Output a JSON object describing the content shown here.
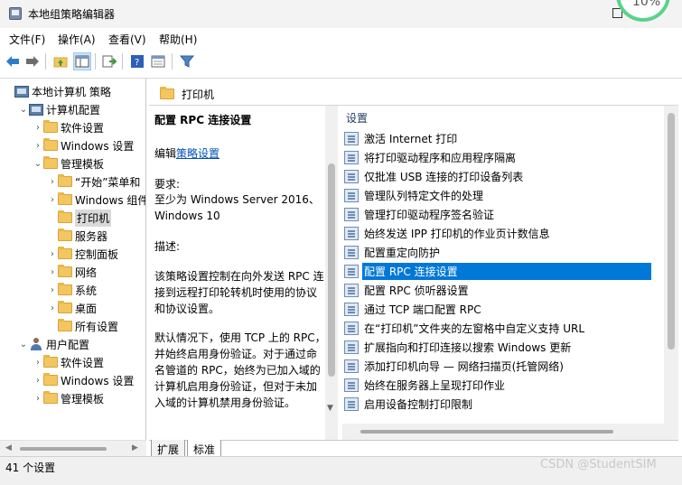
{
  "window": {
    "title": "本地组策略编辑器",
    "overlay_badge": "10%"
  },
  "menu": [
    "文件(F)",
    "操作(A)",
    "查看(V)",
    "帮助(H)"
  ],
  "toolbar": {
    "icons": [
      "back-arrow-icon",
      "forward-arrow-icon",
      "folder-up-icon",
      "show-hide-tree-icon",
      "export-list-icon",
      "help-icon",
      "properties-icon",
      "filter-icon"
    ]
  },
  "tree": [
    {
      "label": "本地计算机 策略",
      "icon": "computer-icon",
      "indent": 0,
      "chevron": ""
    },
    {
      "label": "计算机配置",
      "icon": "computer-icon",
      "indent": 1,
      "chevron": "expanded"
    },
    {
      "label": "软件设置",
      "icon": "folder-icon",
      "indent": 2,
      "chevron": "collapsed"
    },
    {
      "label": "Windows 设置",
      "icon": "folder-icon",
      "indent": 2,
      "chevron": "collapsed"
    },
    {
      "label": "管理模板",
      "icon": "folder-icon",
      "indent": 2,
      "chevron": "expanded"
    },
    {
      "label": "“开始”菜单和",
      "icon": "folder-icon",
      "indent": 3,
      "chevron": "collapsed"
    },
    {
      "label": "Windows 组件",
      "icon": "folder-icon",
      "indent": 3,
      "chevron": "collapsed"
    },
    {
      "label": "打印机",
      "icon": "folder-icon",
      "indent": 3,
      "chevron": "",
      "selected": true
    },
    {
      "label": "服务器",
      "icon": "folder-icon",
      "indent": 3,
      "chevron": ""
    },
    {
      "label": "控制面板",
      "icon": "folder-icon",
      "indent": 3,
      "chevron": "collapsed"
    },
    {
      "label": "网络",
      "icon": "folder-icon",
      "indent": 3,
      "chevron": "collapsed"
    },
    {
      "label": "系统",
      "icon": "folder-icon",
      "indent": 3,
      "chevron": "collapsed"
    },
    {
      "label": "桌面",
      "icon": "folder-icon",
      "indent": 3,
      "chevron": "collapsed"
    },
    {
      "label": "所有设置",
      "icon": "folder-icon",
      "indent": 3,
      "chevron": ""
    },
    {
      "label": "用户配置",
      "icon": "user-icon",
      "indent": 1,
      "chevron": "expanded"
    },
    {
      "label": "软件设置",
      "icon": "folder-icon",
      "indent": 2,
      "chevron": "collapsed"
    },
    {
      "label": "Windows 设置",
      "icon": "folder-icon",
      "indent": 2,
      "chevron": "collapsed"
    },
    {
      "label": "管理模板",
      "icon": "folder-icon",
      "indent": 2,
      "chevron": "collapsed"
    }
  ],
  "pane": {
    "header": "打印机",
    "column_header": "设置"
  },
  "description": {
    "title": "配置 RPC 连接设置",
    "edit_prefix": "编辑",
    "edit_link": "策略设置",
    "requirements_label": "要求:",
    "requirements": "至少为 Windows Server 2016、Windows 10",
    "description_label": "描述:",
    "description": "该策略设置控制在向外发送 RPC 连接到远程打印轮转机时使用的协议和协议设置。",
    "default_text": "默认情况下，使用 TCP 上的 RPC，并始终启用身份验证。对于通过命名管道的 RPC，始终为已加入域的计算机启用身份验证，但对于未加入域的计算机禁用身份验证。"
  },
  "settings": [
    "激活 Internet 打印",
    "将打印驱动程序和应用程序隔离",
    "仅批准 USB 连接的打印设备列表",
    "管理队列特定文件的处理",
    "管理打印驱动程序签名验证",
    "始终发送 IPP 打印机的作业页计数信息",
    "配置重定向防护",
    "配置 RPC 连接设置",
    "配置 RPC 侦听器设置",
    "通过 TCP 端口配置 RPC",
    "在“打印机”文件夹的左窗格中自定义支持 URL",
    "扩展指向和打印连接以搜索 Windows 更新",
    "添加打印机向导 — 网络扫描页(托管网络)",
    "始终在服务器上呈现打印作业",
    "启用设备控制打印限制"
  ],
  "selected_setting_index": 7,
  "tabs": [
    "扩展",
    "标准"
  ],
  "status": {
    "text": "41 个设置"
  },
  "watermark": "CSDN @StudentSIM",
  "colors": {
    "selection": "#0078d7",
    "link": "#0050b4",
    "folder": "#f2c661"
  }
}
